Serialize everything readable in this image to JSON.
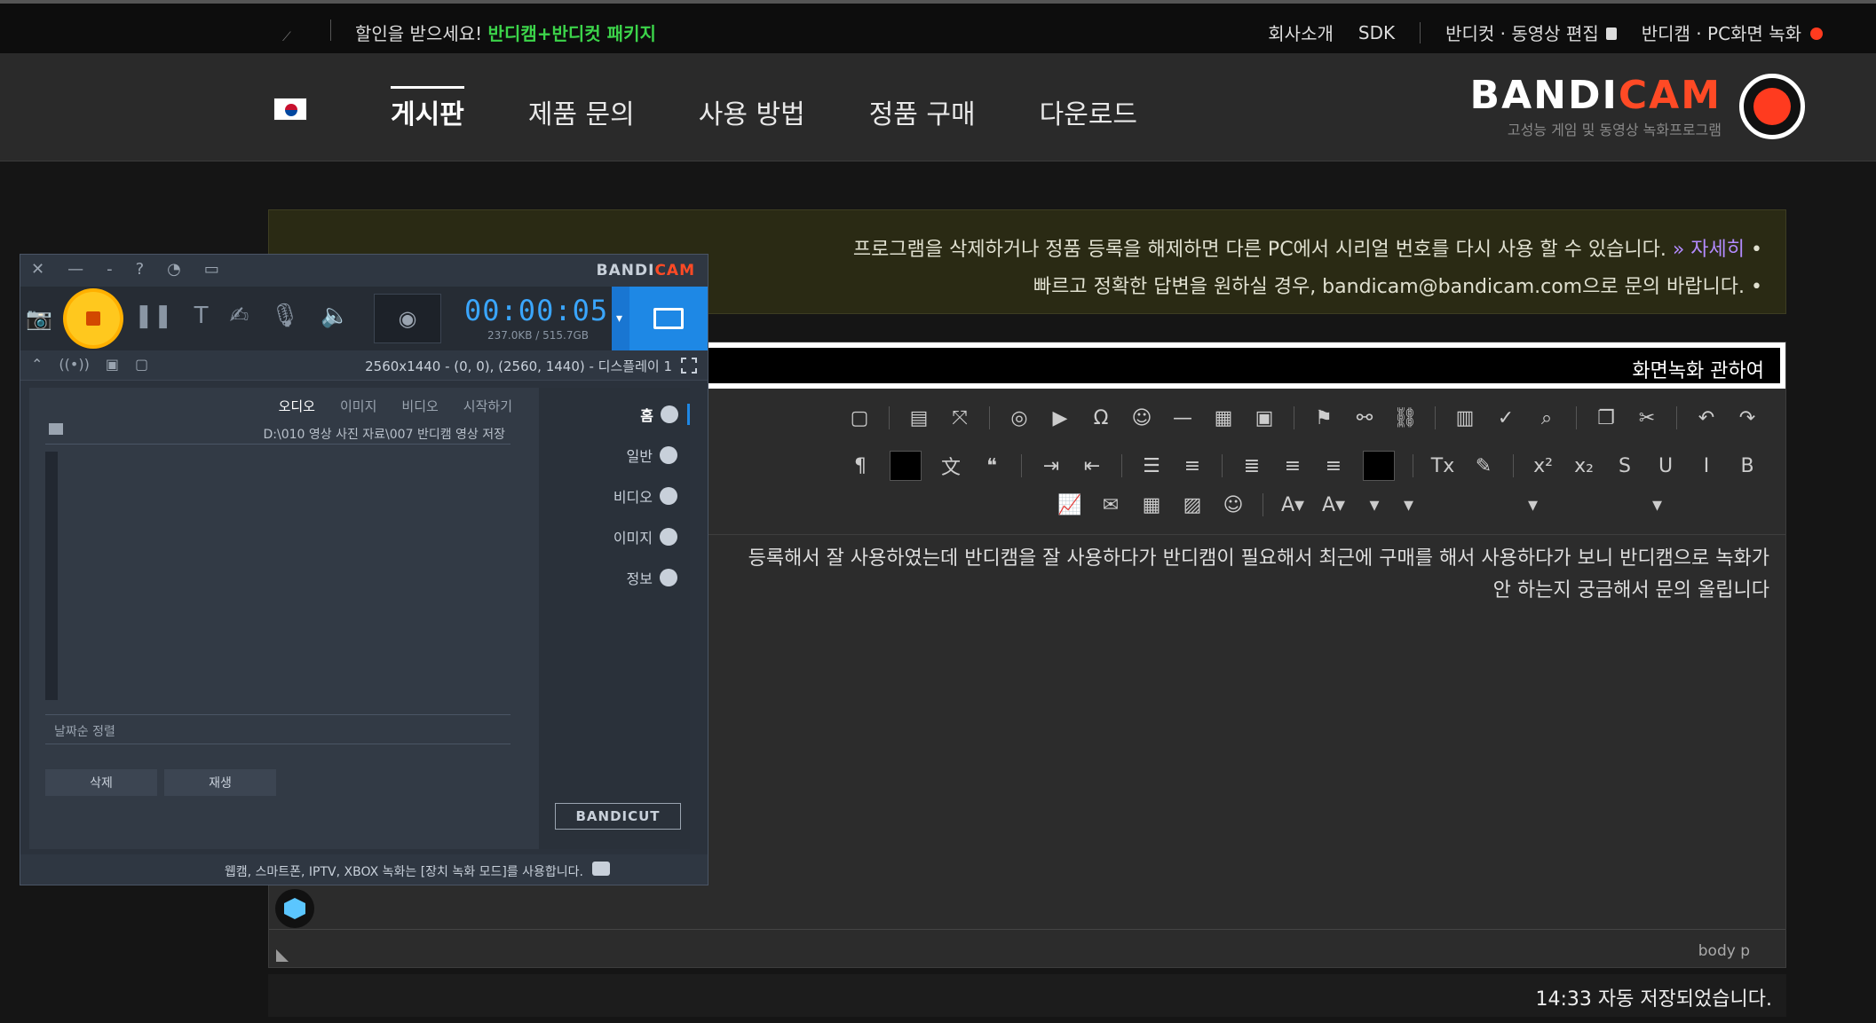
{
  "topbar": {
    "promo_text": "할인을 받으세요!",
    "promo_highlight": "반디캠+반디컷 패키지",
    "site_title": "반디캠 · PC화면 녹화",
    "editor_link": "반디컷 · 동영상 편집",
    "sdk": "SDK",
    "company": "회사소개"
  },
  "nav": {
    "logo_brand_white": "BANDI",
    "logo_brand_red": "CAM",
    "logo_sub": "고성능 게임 및 동영상 녹화프로그램",
    "menu": [
      "게시판",
      "제품 문의",
      "사용 방법",
      "정품 구매",
      "다운로드"
    ],
    "active_index": 0
  },
  "notice": {
    "line1": "프로그램을 삭제하거나 정품 등록을 해제하면 다른 PC에서 시리얼 번호를 다시 사용 할 수 있습니다.",
    "line1_more": "» 자세히",
    "line2": "빠르고 정확한 답변을 원하실 경우, bandicam@bandicam.com으로 문의 바랍니다."
  },
  "editor": {
    "title_value": "화면녹화 관하여",
    "content_line1": "등록해서 잘 사용하였는데 반디캠을 잘 사용하다가 반디캠이 필요해서 최근에 구매를 해서 사용하다가 보니 반디캠으로 녹화가",
    "content_line2": "안 하는지 궁금해서 문의 올립니다",
    "path_tag": "body  p",
    "autosave": "14:33 자동 저장되었습니다."
  },
  "bandicam": {
    "logo_white": "BANDI",
    "logo_red": "CAM",
    "timer": "00:00:05",
    "size": "237.0KB / 515.7GB",
    "area_text": "2560x1440 - (0, 0), (2560, 1440) - 디스플레이 1",
    "sidebar": [
      "홈",
      "일반",
      "비디오",
      "이미지",
      "정보"
    ],
    "tabs": [
      "오디오",
      "이미지",
      "비디오",
      "시작하기"
    ],
    "active_tab": 0,
    "path": "D:\\010 영상 사진 자료\\007 반디캠 영상 저장",
    "sort_label": "날짜순 정렬",
    "btn_play": "재생",
    "btn_delete": "삭제",
    "bandicut_label": "BANDICUT",
    "footer_tip": "웹캠, 스마트폰, IPTV, XBOX 녹화는 [장치 녹화 모드]를 사용합니다."
  }
}
